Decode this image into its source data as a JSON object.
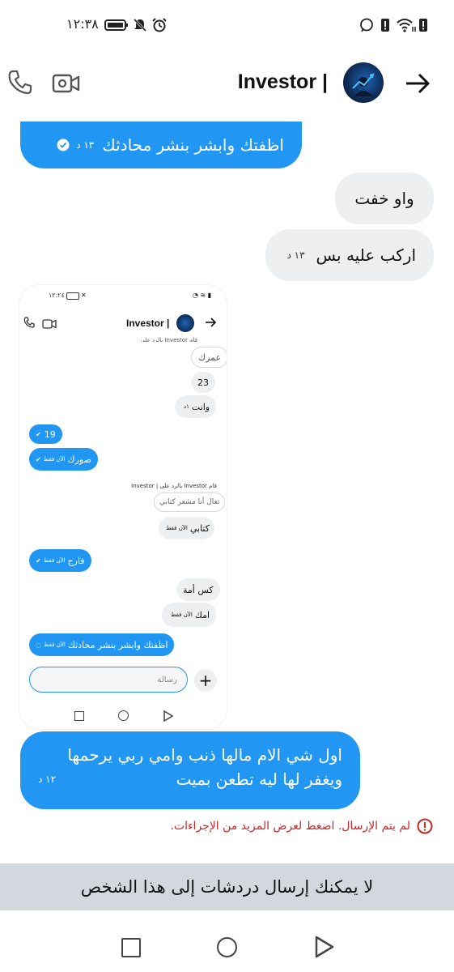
{
  "status_bar": {
    "time": "١٢:٣٨",
    "icons": [
      "battery-icon",
      "mute-icon",
      "alarm-icon",
      "messenger-bubble-icon",
      "alert-icon",
      "wifi-icon",
      "battery-alert-icon"
    ]
  },
  "header": {
    "name": "Investor |",
    "call_icon": "phone-icon",
    "video_icon": "video-camera-icon",
    "back_icon": "arrow-right-icon"
  },
  "messages": [
    {
      "side": "outgoing",
      "text": "اظفتك وابشر بنشر محادثك",
      "time": "١٣ د",
      "status": "seen-check"
    },
    {
      "side": "incoming",
      "text": "واو خفت"
    },
    {
      "side": "incoming",
      "text": "اركب عليه بس",
      "time": "١٣ د"
    },
    {
      "side": "outgoing",
      "text_lines": [
        "اول شي الام مالها ذنب وامي ربي يرحمها",
        "ويغفر لها ليه تطعن بميت"
      ],
      "time": "١٢ د"
    }
  ],
  "embedded_screenshot": {
    "status_time": "١٢:٢٤",
    "header_name": "Investor |",
    "top_partial": "قام Investor بالرد على",
    "messages": [
      {
        "side": "incoming",
        "text": "عمرك",
        "style": "outline"
      },
      {
        "side": "incoming",
        "text": "23"
      },
      {
        "side": "incoming",
        "text": "وانت",
        "time": "١د"
      },
      {
        "side": "outgoing",
        "text": "19"
      },
      {
        "side": "outgoing",
        "text": "صورك",
        "time": "الآن فقط"
      },
      {
        "side": "incoming",
        "reply_header": "قام Investor بالرد على | Investor",
        "quoted": "تعال أنا مشعر كتابي",
        "text": "كتابي",
        "time": "الآن فقط"
      },
      {
        "side": "outgoing",
        "text": "فارج",
        "time": "الآن فقط"
      },
      {
        "side": "incoming",
        "text": "كس أمة"
      },
      {
        "side": "incoming",
        "text": "امك",
        "time": "الآن فقط"
      },
      {
        "side": "outgoing",
        "text": "اظفتك وابشر بنشر محادثك",
        "time": "الآن فقط"
      }
    ],
    "input_placeholder": "رسالة"
  },
  "error": {
    "text": "لم يتم الإرسال. اضغط لعرض المزيد من الإجراءات."
  },
  "banner": {
    "text": "لا يمكنك إرسال دردشات إلى هذا الشخص"
  },
  "nav": {
    "recents_icon": "square-icon",
    "home_icon": "circle-icon",
    "back_icon": "triangle-back-icon"
  },
  "colors": {
    "blue": "#2196f3",
    "grey_bubble": "#eeeff1",
    "error": "#c62828",
    "banner": "#d3d8de"
  }
}
